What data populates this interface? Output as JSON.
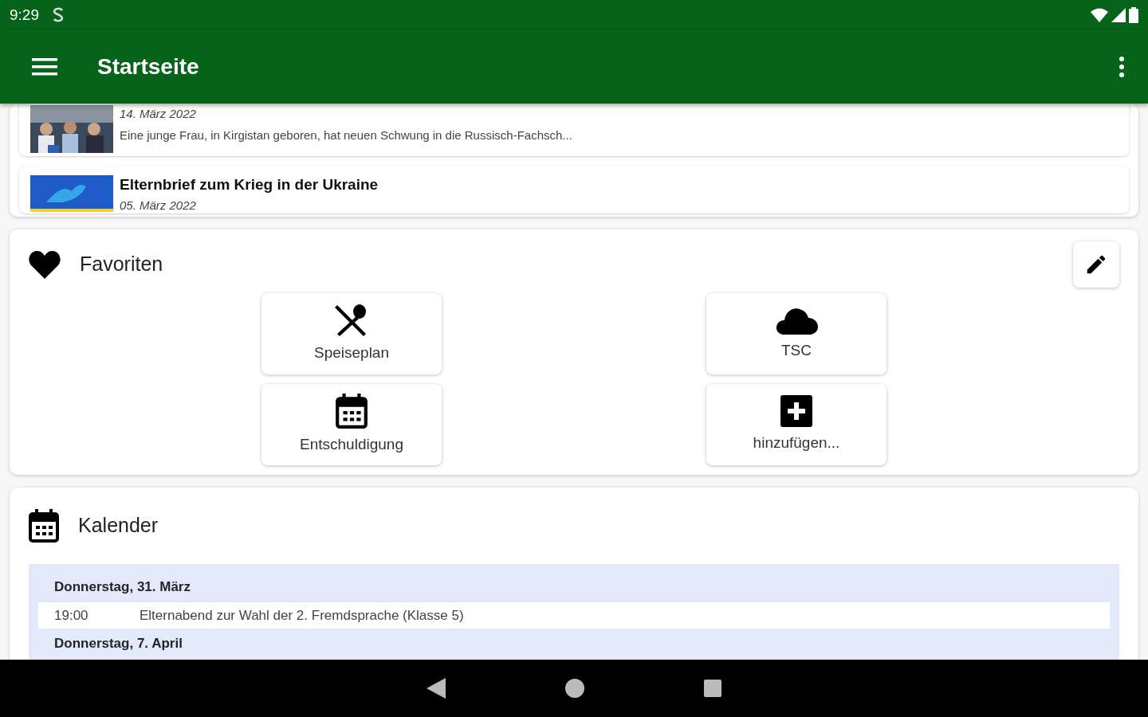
{
  "status_bar": {
    "time": "9:29"
  },
  "app_bar": {
    "title": "Startseite"
  },
  "news": [
    {
      "date": "14. März 2022",
      "snippet": "Eine junge Frau, in Kirgistan geboren, hat neuen Schwung in die Russisch-Fachsch..."
    },
    {
      "title": "Elternbrief zum Krieg in der Ukraine",
      "date": "05. März 2022"
    }
  ],
  "favorites": {
    "title": "Favoriten",
    "items": [
      {
        "label": "Speiseplan"
      },
      {
        "label": "TSC"
      },
      {
        "label": "Entschuldigung"
      },
      {
        "label": "hinzufügen..."
      }
    ]
  },
  "calendar": {
    "title": "Kalender",
    "days": [
      {
        "date": "Donnerstag, 31. März",
        "events": [
          {
            "time": "19:00",
            "title": "Elternabend zur Wahl der 2. Fremdsprache (Klasse 5)"
          }
        ]
      },
      {
        "date": "Donnerstag, 7. April"
      }
    ]
  }
}
